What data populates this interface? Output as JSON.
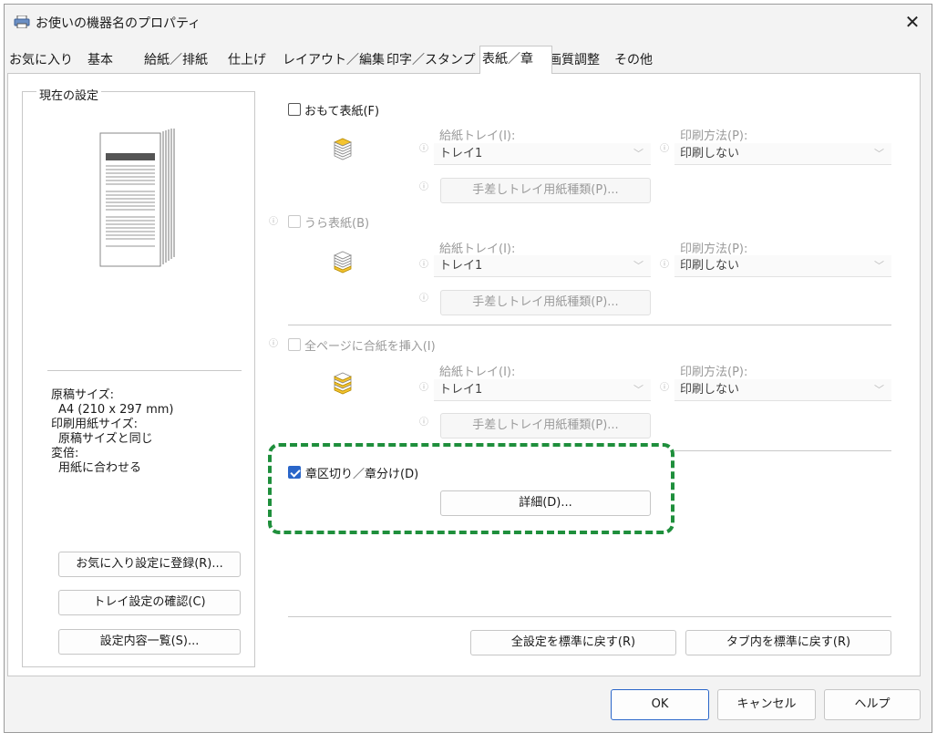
{
  "window": {
    "title": "お使いの機器名のプロパティ",
    "close_symbol": "✕"
  },
  "tabs": [
    "お気に入り",
    "基本",
    "給紙／排紙",
    "仕上げ",
    "レイアウト／編集",
    "印字／スタンプ",
    "表紙／章",
    "画質調整",
    "その他"
  ],
  "left": {
    "group_title": "現在の設定",
    "info": {
      "orig_size_label": "原稿サイズ:",
      "orig_size_value": "A4 (210 x 297 mm)",
      "paper_size_label": "印刷用紙サイズ:",
      "paper_size_value": "原稿サイズと同じ",
      "scale_label": "変倍:",
      "scale_value": "用紙に合わせる"
    },
    "buttons": {
      "register": "お気に入り設定に登録(R)...",
      "tray_check": "トレイ設定の確認(C)",
      "settings_list": "設定内容一覧(S)..."
    }
  },
  "front_cover": {
    "checkbox_label": "おもて表紙(F)",
    "tray_label": "給紙トレイ(I):",
    "tray_value": "トレイ1",
    "print_label": "印刷方法(P):",
    "print_value": "印刷しない",
    "bypass_button": "手差しトレイ用紙種類(P)..."
  },
  "back_cover": {
    "checkbox_label": "うら表紙(B)",
    "tray_label": "給紙トレイ(I):",
    "tray_value": "トレイ1",
    "print_label": "印刷方法(P):",
    "print_value": "印刷しない",
    "bypass_button": "手差しトレイ用紙種類(P)..."
  },
  "insert_all": {
    "checkbox_label": "全ページに合紙を挿入(I)",
    "tray_label": "給紙トレイ(I):",
    "tray_value": "トレイ1",
    "print_label": "印刷方法(P):",
    "print_value": "印刷しない",
    "bypass_button": "手差しトレイ用紙種類(P)..."
  },
  "chapter": {
    "checkbox_label": "章区切り／章分け(D)",
    "checked": true,
    "detail_button": "詳細(D)..."
  },
  "bottom_buttons": {
    "reset_all": "全設定を標準に戻す(R)",
    "reset_tab": "タブ内を標準に戻す(R)"
  },
  "dialog_buttons": {
    "ok": "OK",
    "cancel": "キャンセル",
    "help": "ヘルプ"
  },
  "info_symbol": "ⓘ",
  "chevron_symbol": "﹀",
  "colors": {
    "highlight": "#1f8f3c",
    "checkbox_checked": "#2a66c9"
  }
}
